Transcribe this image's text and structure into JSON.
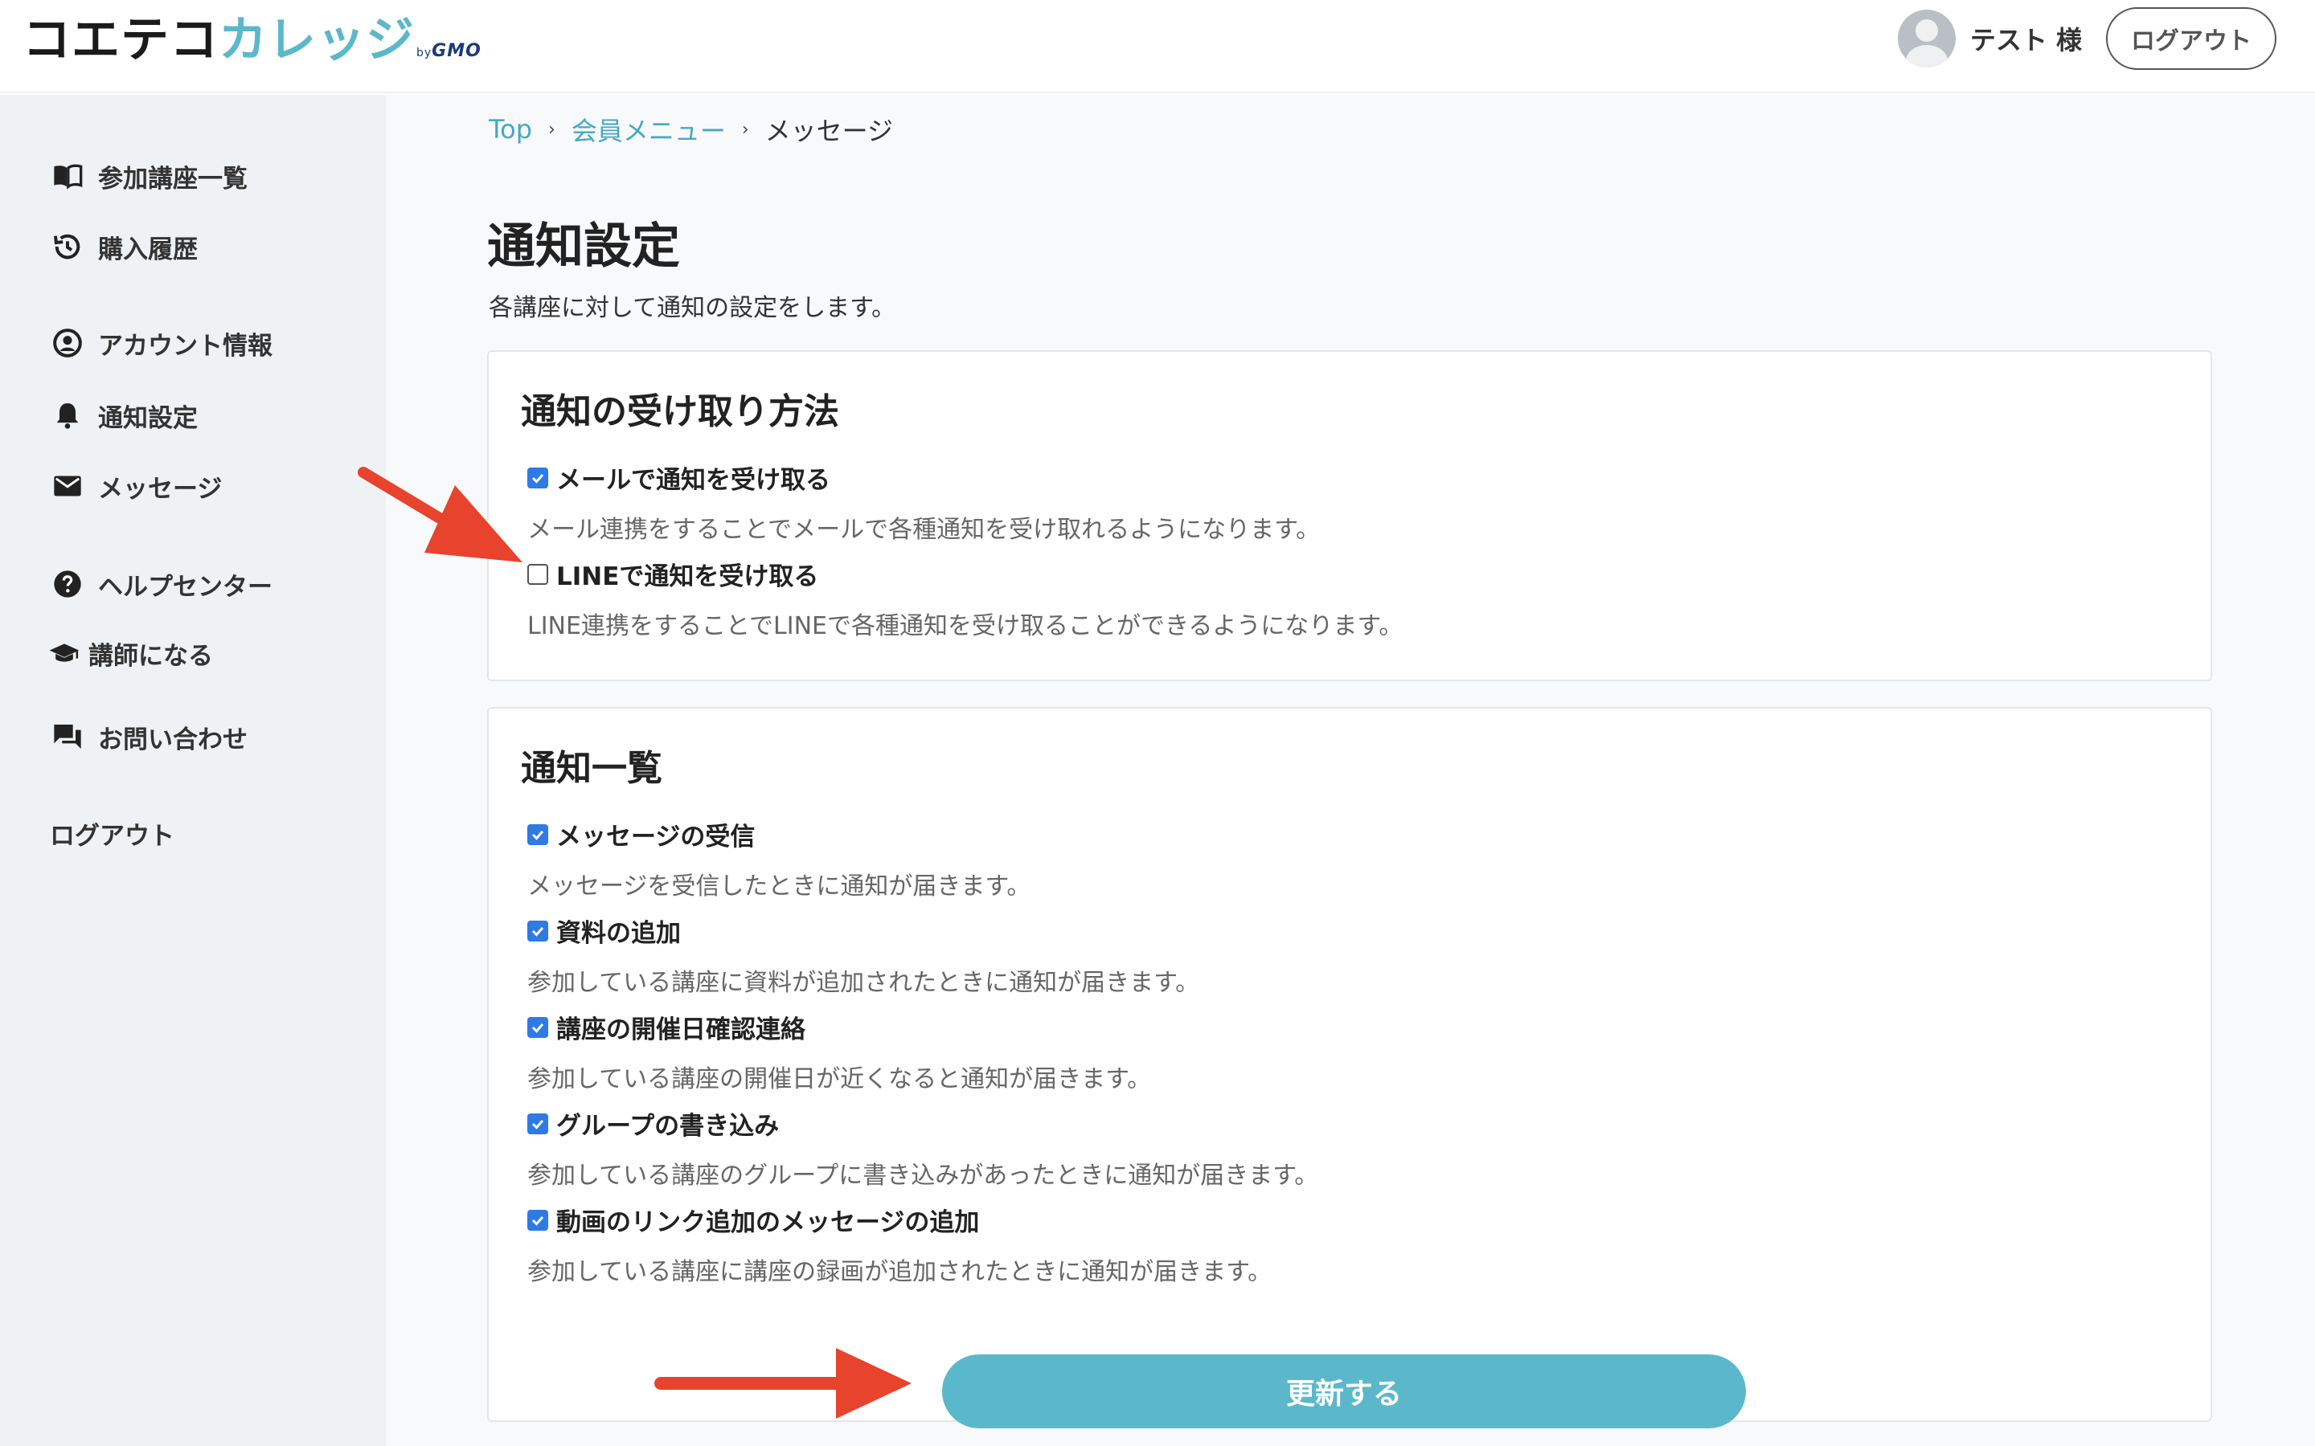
{
  "brand": {
    "name_part1": "コエテコ",
    "name_part2": "カレッジ",
    "by": "by",
    "gmo": "GMO",
    "brand_color": "#5bb8cb"
  },
  "header": {
    "user_name": "テスト 様",
    "logout_label": "ログアウト"
  },
  "sidebar": {
    "items": [
      {
        "label": "参加講座一覧",
        "icon": "book-icon"
      },
      {
        "label": "購入履歴",
        "icon": "history-icon"
      },
      {
        "label": "アカウント情報",
        "icon": "account-icon"
      },
      {
        "label": "通知設定",
        "icon": "bell-icon"
      },
      {
        "label": "メッセージ",
        "icon": "mail-icon"
      },
      {
        "label": "ヘルプセンター",
        "icon": "help-icon"
      },
      {
        "label": "講師になる",
        "icon": "graduation-cap-icon"
      },
      {
        "label": "お問い合わせ",
        "icon": "chat-icon"
      },
      {
        "label": "ログアウト",
        "icon": ""
      }
    ]
  },
  "breadcrumb": {
    "items": [
      "Top",
      "会員メニュー",
      "メッセージ"
    ],
    "separator": "›"
  },
  "page": {
    "title": "通知設定",
    "description": "各講座に対して通知の設定をします。"
  },
  "receive_methods": {
    "title": "通知の受け取り方法",
    "options": [
      {
        "label": "メールで通知を受け取る",
        "checked": true,
        "description": "メール連携をすることでメールで各種通知を受け取れるようになります。"
      },
      {
        "label": "LINEで通知を受け取る",
        "checked": false,
        "description": "LINE連携をすることでLINEで各種通知を受け取ることができるようになります。"
      }
    ]
  },
  "notification_list": {
    "title": "通知一覧",
    "options": [
      {
        "label": "メッセージの受信",
        "checked": true,
        "description": "メッセージを受信したときに通知が届きます。"
      },
      {
        "label": "資料の追加",
        "checked": true,
        "description": "参加している講座に資料が追加されたときに通知が届きます。"
      },
      {
        "label": "講座の開催日確認連絡",
        "checked": true,
        "description": "参加している講座の開催日が近くなると通知が届きます。"
      },
      {
        "label": "グループの書き込み",
        "checked": true,
        "description": "参加している講座のグループに書き込みがあったときに通知が届きます。"
      },
      {
        "label": "動画のリンク追加のメッセージの追加",
        "checked": true,
        "description": "参加している講座に講座の録画が追加されたときに通知が届きます。"
      }
    ]
  },
  "update_button": {
    "label": "更新する"
  },
  "annotation": {
    "arrow_color": "#e8432d"
  }
}
